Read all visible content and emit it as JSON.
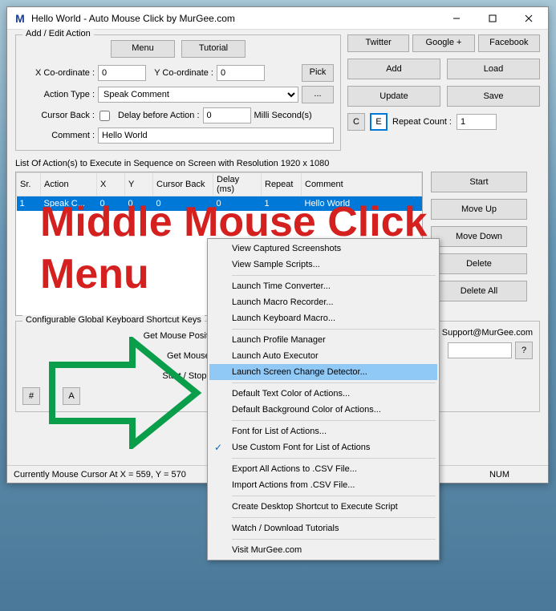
{
  "window": {
    "title": "Hello World - Auto Mouse Click by MurGee.com"
  },
  "topbuttons": {
    "menu": "Menu",
    "tutorial": "Tutorial",
    "twitter": "Twitter",
    "google": "Google +",
    "facebook": "Facebook"
  },
  "addedit": {
    "legend": "Add / Edit Action",
    "xlabel": "X Co-ordinate :",
    "xval": "0",
    "ylabel": "Y Co-ordinate :",
    "yval": "0",
    "pick": "Pick",
    "actiontype_label": "Action Type :",
    "actiontype_val": "Speak Comment",
    "dots": "...",
    "cursorback": "Cursor Back :",
    "delaybefore": "Delay before Action :",
    "delayval": "0",
    "ms": "Milli Second(s)",
    "commentlabel": "Comment :",
    "commentval": "Hello World",
    "c": "C",
    "e": "E",
    "repeatlabel": "Repeat Count :",
    "repeatval": "1"
  },
  "sidebtns": {
    "add": "Add",
    "load": "Load",
    "update": "Update",
    "save": "Save"
  },
  "listlabel": "List Of Action(s) to Execute in Sequence on Screen with Resolution 1920 x 1080",
  "table": {
    "cols": [
      "Sr.",
      "Action",
      "X",
      "Y",
      "Cursor Back",
      "Delay (ms)",
      "Repeat",
      "Comment"
    ],
    "row": [
      "1",
      "Speak C...",
      "0",
      "0",
      "0",
      "0",
      "1",
      "Hello World"
    ]
  },
  "listbtns": {
    "start": "Start",
    "moveup": "Move Up",
    "movedown": "Move Down",
    "delete": "Delete",
    "deleteall": "Delete All"
  },
  "shortcut": {
    "legend": "Configurable Global Keyboard Shortcut Keys",
    "getmouse": "Get Mouse Position & Add Action",
    "getcursor": "Get Mouse Cursor Position",
    "startstop": "Start / Stop Script Execution",
    "support": "Support@MurGee.com",
    "hash": "#",
    "a": "A",
    "q": "?"
  },
  "status": {
    "text": "Currently Mouse Cursor At X = 559, Y = 570",
    "num": "NUM"
  },
  "menu": {
    "items": [
      "View Captured Screenshots",
      "View Sample Scripts...",
      "",
      "Launch Time Converter...",
      "Launch Macro Recorder...",
      "Launch Keyboard Macro...",
      "",
      "Launch Profile Manager",
      "Launch Auto Executor",
      "Launch Screen Change Detector...",
      "",
      "Default Text Color of Actions...",
      "Default Background Color of Actions...",
      "",
      "Font for List of Actions...",
      "Use Custom Font for List of Actions",
      "",
      "Export All Actions to .CSV File...",
      "Import Actions from .CSV File...",
      "",
      "Create Desktop Shortcut to Execute Script",
      "",
      "Watch / Download Tutorials",
      "",
      "Visit MurGee.com"
    ],
    "highlighted": "Launch Screen Change Detector...",
    "checked": "Use Custom Font for List of Actions"
  },
  "overlay": {
    "line1": "Middle Mouse Click",
    "line2": "Menu"
  }
}
